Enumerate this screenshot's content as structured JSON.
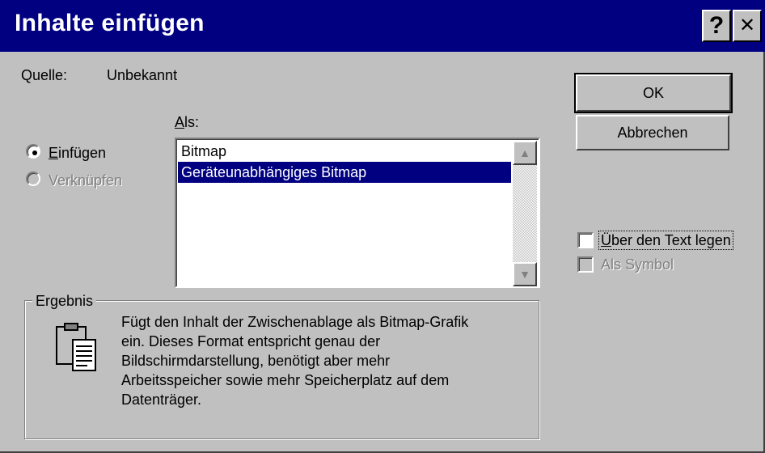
{
  "window": {
    "title": "Inhalte einfügen",
    "help_label": "?",
    "close_label": "✕"
  },
  "source": {
    "label": "Quelle:",
    "value": "Unbekannt"
  },
  "as": {
    "label_prefix": "A",
    "label_rest": "ls:",
    "items": [
      "Bitmap",
      "Geräteunabhängiges Bitmap"
    ],
    "selected_index": 1
  },
  "options": {
    "paste": {
      "access_key": "E",
      "rest": "infügen",
      "checked": true
    },
    "link": {
      "label": "Verknüpfen",
      "enabled": false
    }
  },
  "buttons": {
    "ok": "OK",
    "cancel": "Abbrechen"
  },
  "checkboxes": {
    "float_over_text": {
      "access_key": "Ü",
      "rest": "ber den Text legen",
      "checked": false
    },
    "as_icon": {
      "label": "Als Symbol",
      "enabled": false
    }
  },
  "result": {
    "label": "Ergebnis",
    "icon": "clipboard-paste-icon",
    "lines": [
      "Fügt den Inhalt der Zwischenablage als Bitmap-Grafik",
      "ein. Dieses Format entspricht genau der",
      "Bildschirmdarstellung, benötigt aber mehr",
      "Arbeitsspeicher sowie mehr Speicherplatz auf dem",
      "Datenträger."
    ]
  },
  "colors": {
    "titlebar": "#000080",
    "face": "#c0c0c0",
    "selection": "#000080"
  }
}
